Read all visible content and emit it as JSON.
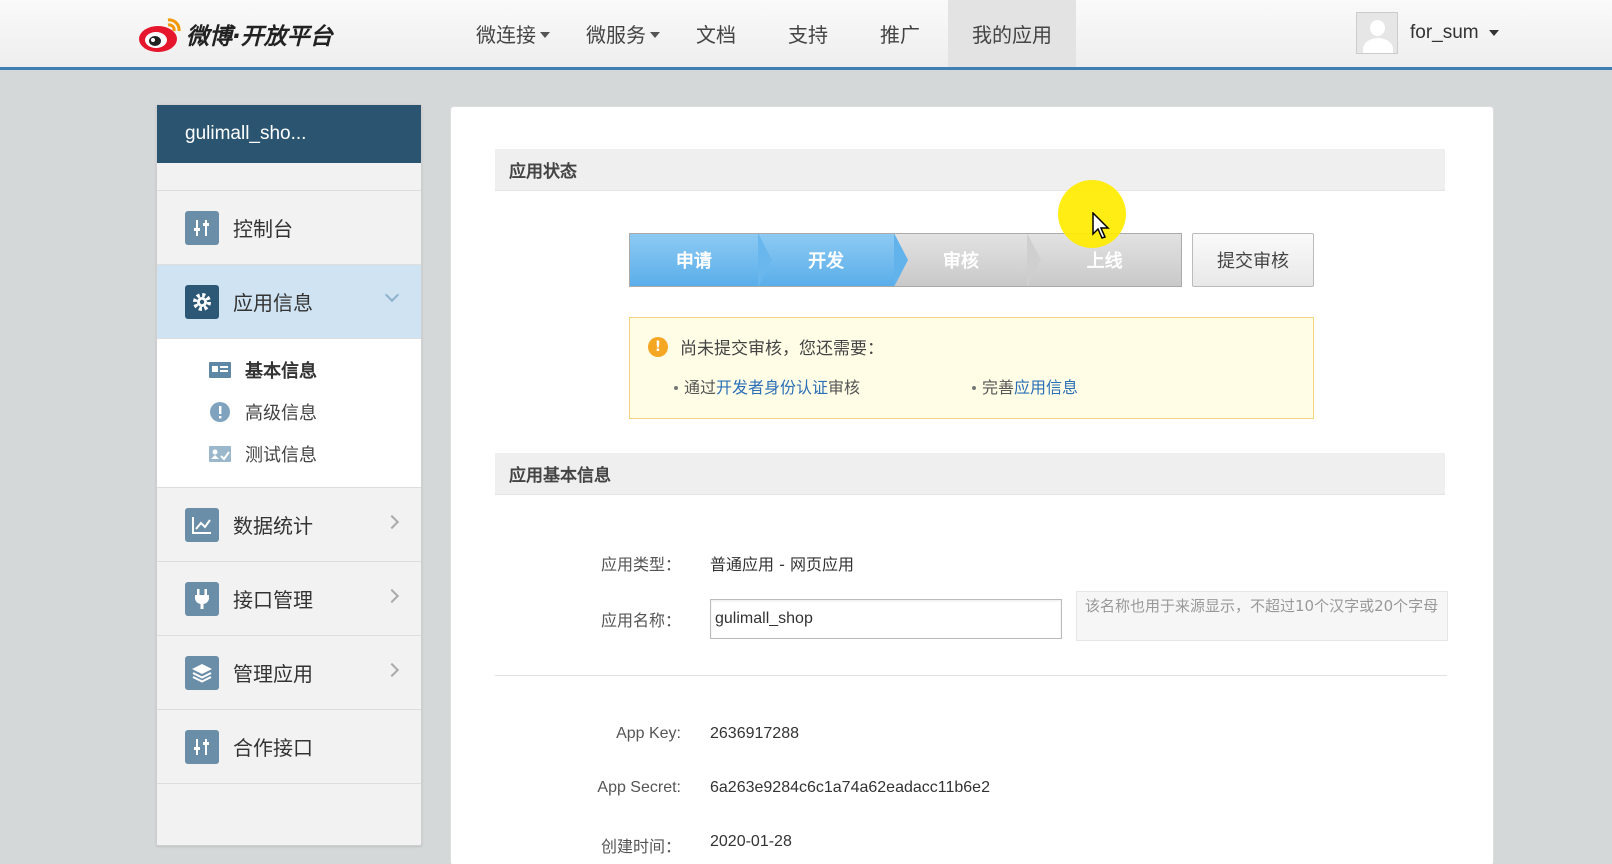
{
  "brand": {
    "name": "微博·开放平台"
  },
  "nav": {
    "items": [
      {
        "label": "微连接",
        "dropdown": true
      },
      {
        "label": "微服务",
        "dropdown": true
      },
      {
        "label": "文档",
        "dropdown": false
      },
      {
        "label": "支持",
        "dropdown": false
      },
      {
        "label": "推广",
        "dropdown": false
      },
      {
        "label": "我的应用",
        "dropdown": false,
        "active": true
      }
    ]
  },
  "user": {
    "name": "for_sum"
  },
  "sidebar": {
    "app_name": "gulimall_sho...",
    "items": [
      {
        "label": "控制台",
        "icon": "sliders-icon"
      },
      {
        "label": "应用信息",
        "icon": "gear-icon",
        "active": true,
        "children": [
          {
            "label": "基本信息",
            "icon": "id-card-icon",
            "selected": true
          },
          {
            "label": "高级信息",
            "icon": "exclamation-icon"
          },
          {
            "label": "测试信息",
            "icon": "test-card-icon"
          }
        ]
      },
      {
        "label": "数据统计",
        "icon": "line-chart-icon"
      },
      {
        "label": "接口管理",
        "icon": "plug-icon"
      },
      {
        "label": "管理应用",
        "icon": "layers-icon"
      },
      {
        "label": "合作接口",
        "icon": "sliders-icon"
      }
    ]
  },
  "status_section": {
    "title": "应用状态",
    "steps": [
      {
        "label": "申请",
        "done": true
      },
      {
        "label": "开发",
        "done": true
      },
      {
        "label": "审核",
        "done": false
      },
      {
        "label": "上线",
        "done": false
      }
    ],
    "submit_label": "提交审核",
    "notice": {
      "message": "尚未提交审核，您还需要：",
      "req1_prefix": "通过",
      "req1_link": "开发者身份认证",
      "req1_suffix": "审核",
      "req2_prefix": "完善",
      "req2_link": "应用信息"
    }
  },
  "basic_section": {
    "title": "应用基本信息",
    "type_label": "应用类型：",
    "type_value": "普通应用 - 网页应用",
    "name_label": "应用名称：",
    "name_value": "gulimall_shop",
    "name_hint": "该名称也用于来源显示，不超过10个汉字或20个字母",
    "key_label": "App Key:",
    "key_value": "2636917288",
    "secret_label": "App Secret:",
    "secret_value": "6a263e9284c6c1a74a62eadacc11b6e2",
    "created_label": "创建时间：",
    "created_value": "2020-01-28"
  },
  "colors": {
    "accent": "#3e7fb4",
    "sidebar_head": "#2a5470",
    "step_done": "#5aaeea",
    "link": "#2b6fb6"
  }
}
